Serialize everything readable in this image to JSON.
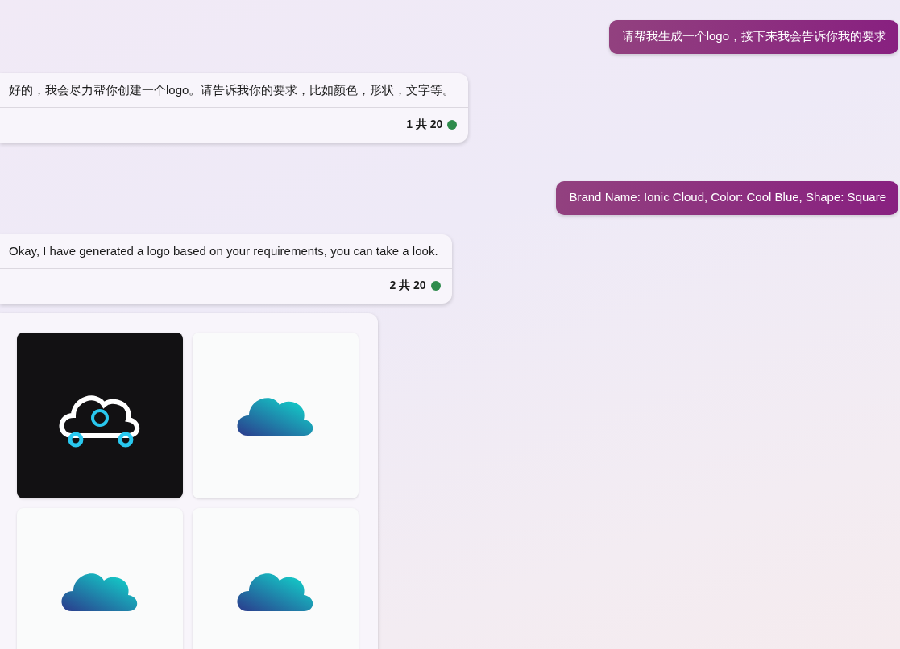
{
  "messages": [
    {
      "kind": "user",
      "text": "请帮我生成一个logo，接下来我会告诉你我的要求"
    },
    {
      "kind": "bot",
      "text": "好的，我会尽力帮你创建一个logo。请告诉我你的要求，比如颜色，形状，文字等。",
      "counter": "1 共 20"
    },
    {
      "kind": "user",
      "text": "Brand Name: Ionic Cloud, Color: Cool Blue, Shape: Square"
    },
    {
      "kind": "bot",
      "text": "Okay, I have generated a logo based on your requirements, you can take a look.",
      "counter": "2 共 20"
    },
    {
      "kind": "images",
      "images": [
        {
          "kind": "dark"
        },
        {
          "kind": "light"
        },
        {
          "kind": "light"
        },
        {
          "kind": "light"
        }
      ]
    }
  ]
}
